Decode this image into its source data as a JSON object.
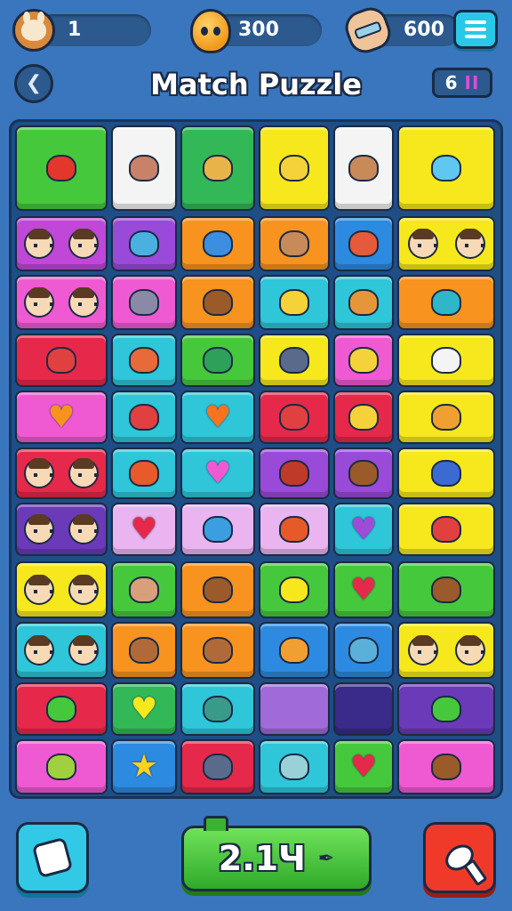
{
  "hud": {
    "level_value": "1",
    "coins_value": "300",
    "gems_value": "600",
    "icons": {
      "avatar": "bunny-avatar-icon",
      "coins": "balloon-coin-icon",
      "gems": "glove-hand-icon",
      "menu": "hamburger-menu-icon"
    }
  },
  "title_row": {
    "title": "Match Puzzle",
    "back_glyph": "❮",
    "level_badge": "6",
    "pause_glyph": "II"
  },
  "board": {
    "tiles": [
      {
        "color": "#46c83c",
        "icon": "red-box-icon",
        "kind": "blob",
        "accent": "#e2372a"
      },
      {
        "color": "#f4f4f4",
        "icon": "bear-face-icon",
        "kind": "blob",
        "accent": "#c9826a"
      },
      {
        "color": "#32b856",
        "icon": "bread-loaf-icon",
        "kind": "blob",
        "accent": "#e8b44a"
      },
      {
        "color": "#f6e81c",
        "icon": "cheese-wedge-icon",
        "kind": "blob",
        "accent": "#f6d23a"
      },
      {
        "color": "#f4f4f4",
        "icon": "lion-face-icon",
        "kind": "blob",
        "accent": "#c98a5a"
      },
      {
        "color": "#f6e81c",
        "icon": "cloud-icon",
        "kind": "blob",
        "accent": "#5ec8f0"
      },
      {
        "color": "#c047d8",
        "icon": "balloon-and-girl-icon",
        "kind": "pair",
        "accent": "#f09a3a"
      },
      {
        "color": "#9a4ad8",
        "icon": "crossed-bandage-icon",
        "kind": "blob",
        "accent": "#4ab0e0"
      },
      {
        "color": "#f7931e",
        "icon": "blue-fish-icon",
        "kind": "blob",
        "accent": "#3b8ee0"
      },
      {
        "color": "#f7931e",
        "icon": "bear-face-icon",
        "kind": "blob",
        "accent": "#c98a5a"
      },
      {
        "color": "#2c8ae0",
        "icon": "monkey-toy-icon",
        "kind": "blob",
        "accent": "#e55a3a"
      },
      {
        "color": "#f6e81c",
        "icon": "bucket-and-boy-icon",
        "kind": "pair",
        "accent": "#a06ad8"
      },
      {
        "color": "#ef5ad2",
        "icon": "chef-and-girl-icon",
        "kind": "pair",
        "accent": "#ffffff"
      },
      {
        "color": "#ef5ad2",
        "icon": "cat-face-icon",
        "kind": "blob",
        "accent": "#8a8aa8"
      },
      {
        "color": "#f7931e",
        "icon": "boar-icon",
        "kind": "blob",
        "accent": "#9a5a2a"
      },
      {
        "color": "#2ec6d8",
        "icon": "jar-icon",
        "kind": "blob",
        "accent": "#f6d23a"
      },
      {
        "color": "#2ec6d8",
        "icon": "onion-icon",
        "kind": "blob",
        "accent": "#e6963a"
      },
      {
        "color": "#f7931e",
        "icon": "balloon-and-cup-icon",
        "kind": "blob",
        "accent": "#2fb6c8"
      },
      {
        "color": "#e6284a",
        "icon": "balloon-and-wrench-icon",
        "kind": "blob",
        "accent": "#e04040"
      },
      {
        "color": "#2ec6d8",
        "icon": "popsicle-icon",
        "kind": "blob",
        "accent": "#e86a3a"
      },
      {
        "color": "#46c83c",
        "icon": "bone-cross-icon",
        "kind": "blob",
        "accent": "#2fa05a"
      },
      {
        "color": "#f6e81c",
        "icon": "dog-silhouette-icon",
        "kind": "blob",
        "accent": "#5a6a8a"
      },
      {
        "color": "#ef5ad2",
        "icon": "diamond-icon",
        "kind": "blob",
        "accent": "#f6d23a"
      },
      {
        "color": "#f6e81c",
        "icon": "cookie-and-ghost-icon",
        "kind": "blob",
        "accent": "#f4f4f4"
      },
      {
        "color": "#ef5ad2",
        "icon": "heart-icon",
        "kind": "heart",
        "accent": "#f7931e"
      },
      {
        "color": "#2ec6d8",
        "icon": "ball-icon",
        "kind": "blob",
        "accent": "#e04040"
      },
      {
        "color": "#2ec6d8",
        "icon": "heart-icon",
        "kind": "heart",
        "accent": "#f7731e"
      },
      {
        "color": "#e6284a",
        "icon": "dog-face-icon",
        "kind": "blob",
        "accent": "#e04040"
      },
      {
        "color": "#e6284a",
        "icon": "butter-icon",
        "kind": "blob",
        "accent": "#f6d23a"
      },
      {
        "color": "#f6e81c",
        "icon": "orange-fruit-icon",
        "kind": "blob",
        "accent": "#f0a030"
      },
      {
        "color": "#e6284a",
        "icon": "cook-and-girl-icon",
        "kind": "pair",
        "accent": "#ffffff"
      },
      {
        "color": "#2ec6d8",
        "icon": "gear-flower-icon",
        "kind": "blob",
        "accent": "#e85a2a"
      },
      {
        "color": "#2ec6d8",
        "icon": "heart-icon",
        "kind": "heart",
        "accent": "#ef5ad2"
      },
      {
        "color": "#9a4ad8",
        "icon": "boot-icon",
        "kind": "blob",
        "accent": "#c03a2a"
      },
      {
        "color": "#9a4ad8",
        "icon": "chocolate-bar-icon",
        "kind": "blob",
        "accent": "#9a5a2a"
      },
      {
        "color": "#f6e81c",
        "icon": "bird-and-elephant-icon",
        "kind": "blob",
        "accent": "#3b6ad0"
      },
      {
        "color": "#6a3ab8",
        "icon": "elf-and-girl-icon",
        "kind": "pair",
        "accent": "#3ab0a8"
      },
      {
        "color": "#e9b4f0",
        "icon": "heart-icon",
        "kind": "heart",
        "accent": "#e6284a"
      },
      {
        "color": "#e9b4f0",
        "icon": "bucket-icon",
        "kind": "blob",
        "accent": "#3b9ee0"
      },
      {
        "color": "#e9b4f0",
        "icon": "fox-face-icon",
        "kind": "blob",
        "accent": "#e65a2a"
      },
      {
        "color": "#2ec6d8",
        "icon": "heart-icon",
        "kind": "heart",
        "accent": "#a04ad8"
      },
      {
        "color": "#f6e81c",
        "icon": "crossed-tools-and-crab-icon",
        "kind": "blob",
        "accent": "#e04040"
      },
      {
        "color": "#f6e81c",
        "icon": "monster-and-girl-icon",
        "kind": "pair",
        "accent": "#e04040"
      },
      {
        "color": "#46c83c",
        "icon": "hippo-icon",
        "kind": "blob",
        "accent": "#d8a07a"
      },
      {
        "color": "#f7931e",
        "icon": "treasure-chest-icon",
        "kind": "blob",
        "accent": "#9a5a2a"
      },
      {
        "color": "#46c83c",
        "icon": "lemon-icon",
        "kind": "blob",
        "accent": "#f6e81c"
      },
      {
        "color": "#46c83c",
        "icon": "heart-icon",
        "kind": "heart",
        "accent": "#e6284a"
      },
      {
        "color": "#46c83c",
        "icon": "squirrel-and-house-icon",
        "kind": "blob",
        "accent": "#9a5a2a"
      },
      {
        "color": "#2ec6d8",
        "icon": "boy-and-girl-icon",
        "kind": "pair",
        "accent": "#e04040"
      },
      {
        "color": "#f7931e",
        "icon": "bear-face-icon",
        "kind": "blob",
        "accent": "#b06a3a"
      },
      {
        "color": "#f7931e",
        "icon": "bear-face-icon",
        "kind": "blob",
        "accent": "#b06a3a"
      },
      {
        "color": "#2c8ae0",
        "icon": "cat-face-icon",
        "kind": "blob",
        "accent": "#f0a030"
      },
      {
        "color": "#2c8ae0",
        "icon": "shark-icon",
        "kind": "blob",
        "accent": "#5ab0d8"
      },
      {
        "color": "#f6e81c",
        "icon": "books-and-girl-icon",
        "kind": "pair",
        "accent": "#e04a8a"
      },
      {
        "color": "#e6284a",
        "icon": "tree-and-microphone-icon",
        "kind": "blob",
        "accent": "#46c83c"
      },
      {
        "color": "#32b856",
        "icon": "heart-icon",
        "kind": "heart",
        "accent": "#f6e81c"
      },
      {
        "color": "#2ec6d8",
        "icon": "open-box-icon",
        "kind": "blob",
        "accent": "#3a9a8a"
      },
      {
        "color": "#a06ad8",
        "icon": "empty-slot",
        "kind": "empty",
        "accent": "#a06ad8"
      },
      {
        "color": "#3a2a8a",
        "icon": "empty-slot",
        "kind": "empty",
        "accent": "#3a2a8a"
      },
      {
        "color": "#6a3ab8",
        "icon": "hand-and-heart-icon",
        "kind": "blob",
        "accent": "#46c83c"
      },
      {
        "color": "#ef5ad2",
        "icon": "cup-and-monster-icon",
        "kind": "blob",
        "accent": "#a0d040"
      },
      {
        "color": "#2c8ae0",
        "icon": "star-icon",
        "kind": "star",
        "accent": "#ffd21e"
      },
      {
        "color": "#e6284a",
        "icon": "rat-icon",
        "kind": "blob",
        "accent": "#5a6a8a"
      },
      {
        "color": "#2ec6d8",
        "icon": "llama-icon",
        "kind": "blob",
        "accent": "#9ad0d8"
      },
      {
        "color": "#46c83c",
        "icon": "heart-icon",
        "kind": "heart",
        "accent": "#e6284a"
      },
      {
        "color": "#ef5ad2",
        "icon": "pot-and-chest-icon",
        "kind": "blob",
        "accent": "#9a5a2a"
      }
    ]
  },
  "bottom": {
    "timer_value": "2.1Ч",
    "timer_icon_glyph": "✒",
    "icons": {
      "hint": "puzzle-piece-icon",
      "hammer": "hammer-icon"
    }
  }
}
